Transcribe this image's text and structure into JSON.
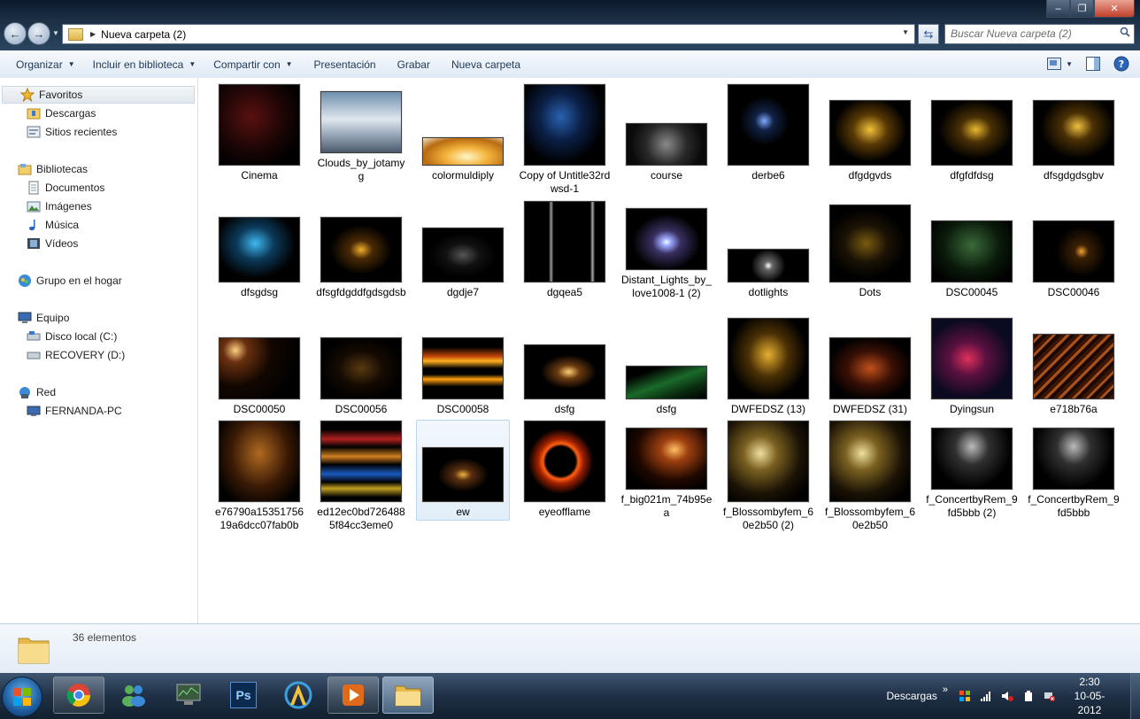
{
  "window": {
    "controls": {
      "minimize": "–",
      "maximize": "❐",
      "close": "✕"
    }
  },
  "address": {
    "path": "Nueva carpeta (2)",
    "search_placeholder": "Buscar Nueva carpeta (2)"
  },
  "toolbar": {
    "organizar": "Organizar",
    "incluir": "Incluir en biblioteca",
    "compartir": "Compartir con",
    "presentacion": "Presentación",
    "grabar": "Grabar",
    "nueva_carpeta": "Nueva carpeta"
  },
  "sidebar": {
    "favoritos": "Favoritos",
    "descargas": "Descargas",
    "sitios": "Sitios recientes",
    "bibliotecas": "Bibliotecas",
    "documentos": "Documentos",
    "imagenes": "Imágenes",
    "musica": "Música",
    "videos": "Vídeos",
    "grupo": "Grupo en el hogar",
    "equipo": "Equipo",
    "disco_c": "Disco local (C:)",
    "recovery": "RECOVERY (D:)",
    "red": "Red",
    "pc": "FERNANDA-PC"
  },
  "files": [
    {
      "name": "Cinema",
      "bg": "radial-gradient(circle at 40% 40%,#5a1010,#1a0505 50%,#000 80%)"
    },
    {
      "name": "Clouds_by_jotamyg",
      "bg": "linear-gradient(180deg,#6f8fae 0%,#dfe7ee 45%,#9aaabb 70%,#4a5a6c 100%)"
    },
    {
      "name": "colormuldiply",
      "bg": "radial-gradient(ellipse at 55% 70%,#fff6c8,#f2b23a 35%,#b86a12 70%,#f3e6c7 100%)"
    },
    {
      "name": "Copy of Untitle32rdwsd-1",
      "bg": "radial-gradient(ellipse at 45% 40%,#2a62b0,#0b1f45 35%,#000 70%)"
    },
    {
      "name": "course",
      "bg": "radial-gradient(circle at 50% 50%,#8a8a8a,#2a2a2a 45%,#0a0a0a 80%)"
    },
    {
      "name": "derbe6",
      "bg": "radial-gradient(circle at 45% 45%,#7fa8ff,#112244 15%,#000 40%)"
    },
    {
      "name": "dfgdgvds",
      "bg": "radial-gradient(ellipse at 50% 45%,#f3c23a,#5a3a05 30%,#000 65%)"
    },
    {
      "name": "dfgfdfdsg",
      "bg": "radial-gradient(ellipse at 55% 45%,#e8b830,#4a3005 25%,#000 60%)"
    },
    {
      "name": "dfsgdgdsgbv",
      "bg": "radial-gradient(ellipse at 55% 40%,#f0c040,#4a3005 25%,#000 60%)"
    },
    {
      "name": "dfsgdsg",
      "bg": "radial-gradient(ellipse at 45% 40%,#3fb8f0,#0c3a5a 30%,#000 65%)"
    },
    {
      "name": "dfsgfdgddfgdsgdsb",
      "bg": "radial-gradient(ellipse at 50% 50%,#f3b02a,#4a2a05 20%,#000 55%)"
    },
    {
      "name": "dgdje7",
      "bg": "radial-gradient(ellipse at 50% 50%,#555,#111 30%,#000 60%)"
    },
    {
      "name": "dgqea5",
      "bg": "linear-gradient(90deg,#000 30%,#999 33%,#000 36%,#000 82%,#aaa 85%,#000 88%)"
    },
    {
      "name": "Distant_Lights_by_love1008-1 (2)",
      "bg": "radial-gradient(ellipse at 50% 55%,#ffffff,#9aa8ff 8%,#3a3060 25%,#000 60%)"
    },
    {
      "name": "dotlights",
      "bg": "radial-gradient(circle at 50% 50%,#fff,#666 10%,#000 40%)"
    },
    {
      "name": "Dots",
      "bg": "radial-gradient(ellipse at 45% 50%,#7a5a10,#1a1205 35%,#000 65%)"
    },
    {
      "name": "DSC00045",
      "bg": "radial-gradient(ellipse at 50% 40%,#3a6a3a,#0a1a0a 50%,#000 85%)"
    },
    {
      "name": "DSC00046",
      "bg": "radial-gradient(circle at 60% 50%,#f0a030,#3a2005 12%,#000 45%)"
    },
    {
      "name": "DSC00050",
      "bg": "radial-gradient(circle at 20% 20%,#ffd080,#6a3010 15%,#120700 45%,#000 80%)"
    },
    {
      "name": "DSC00056",
      "bg": "radial-gradient(ellipse at 50% 50%,#5a3a10,#140a02 40%,#000 75%)"
    },
    {
      "name": "DSC00058",
      "bg": "linear-gradient(180deg,#000 15%,#c0440a 30%,#ffb020 38%,#000 50%,#000 60%,#ffa010 68%,#000 80%)"
    },
    {
      "name": "dsfg",
      "bg": "radial-gradient(ellipse at 55% 50%,#ffd070,#6a3a10 18%,#000 45%)"
    },
    {
      "name": "dsfg",
      "bg": "linear-gradient(160deg,#000 20%,#1a6a2a 50%,#0a2a10 75%,#000 100%)"
    },
    {
      "name": "DWFEDSZ (13)",
      "bg": "radial-gradient(ellipse at 50% 45%,#e8b030,#4a3005 35%,#000 70%)"
    },
    {
      "name": "DWFEDSZ (31)",
      "bg": "radial-gradient(ellipse at 50% 50%,#c0501a,#3a1005 40%,#000 75%)"
    },
    {
      "name": "Dyingsun",
      "bg": "radial-gradient(ellipse at 45% 50%,#e0305a,#5a1040 30%,#0a0a20 70%)"
    },
    {
      "name": "e718b76a",
      "bg": "repeating-linear-gradient(135deg,#3a1505 0 4px,#a8501a 4px 7px,#1a0802 7px 11px)"
    },
    {
      "name": "e76790a1535175619a6dcc07fab0b",
      "bg": "radial-gradient(ellipse at 50% 40%,#b06a20,#3a1a05 50%,#000 85%)"
    },
    {
      "name": "ed12ec0bd7264885f84cc3eme0",
      "bg": "linear-gradient(180deg,#000 10%,#b02020 22%,#000 32%,#d08020 44%,#000 54%,#1a5ac0 66%,#000 76%,#c0a020 84%,#000 95%)"
    },
    {
      "name": "ew",
      "bg": "radial-gradient(ellipse at 50% 50%,#f0b040,#5a3010 15%,#000 45%)"
    },
    {
      "name": "eyeofflame",
      "bg": "radial-gradient(circle at 45% 50%,#000 25%,#ff6010 30%,#a02000 38%,#000 55%)"
    },
    {
      "name": "f_big021m_74b95ea",
      "bg": "radial-gradient(ellipse at 60% 35%,#ffc060,#a04010 20%,#200800 55%,#000 80%)"
    },
    {
      "name": "f_Blossombyfem_60e2b50 (2)",
      "bg": "radial-gradient(ellipse at 40% 40%,#f0e0a0,#7a6020 25%,#1a1205 60%,#000 85%)"
    },
    {
      "name": "f_Blossombyfem_60e2b50",
      "bg": "radial-gradient(ellipse at 40% 40%,#f0e0a0,#7a6020 25%,#1a1205 60%,#000 85%)"
    },
    {
      "name": "f_ConcertbyRem_9fd5bbb (2)",
      "bg": "radial-gradient(ellipse at 50% 30%,#bbbbbb,#303030 30%,#000 70%)"
    },
    {
      "name": "f_ConcertbyRem_9fd5bbb",
      "bg": "radial-gradient(ellipse at 50% 30%,#bbbbbb,#303030 30%,#000 70%)"
    }
  ],
  "status": {
    "count": "36 elementos"
  },
  "taskbar": {
    "downloads_label": "Descargas",
    "time": "2:30",
    "date": "10-05-2012",
    "ps_label": "Ps"
  },
  "colors": {
    "accent": "#1e3754",
    "selection": "#e2eef9",
    "taskbar": "#1f3046"
  }
}
